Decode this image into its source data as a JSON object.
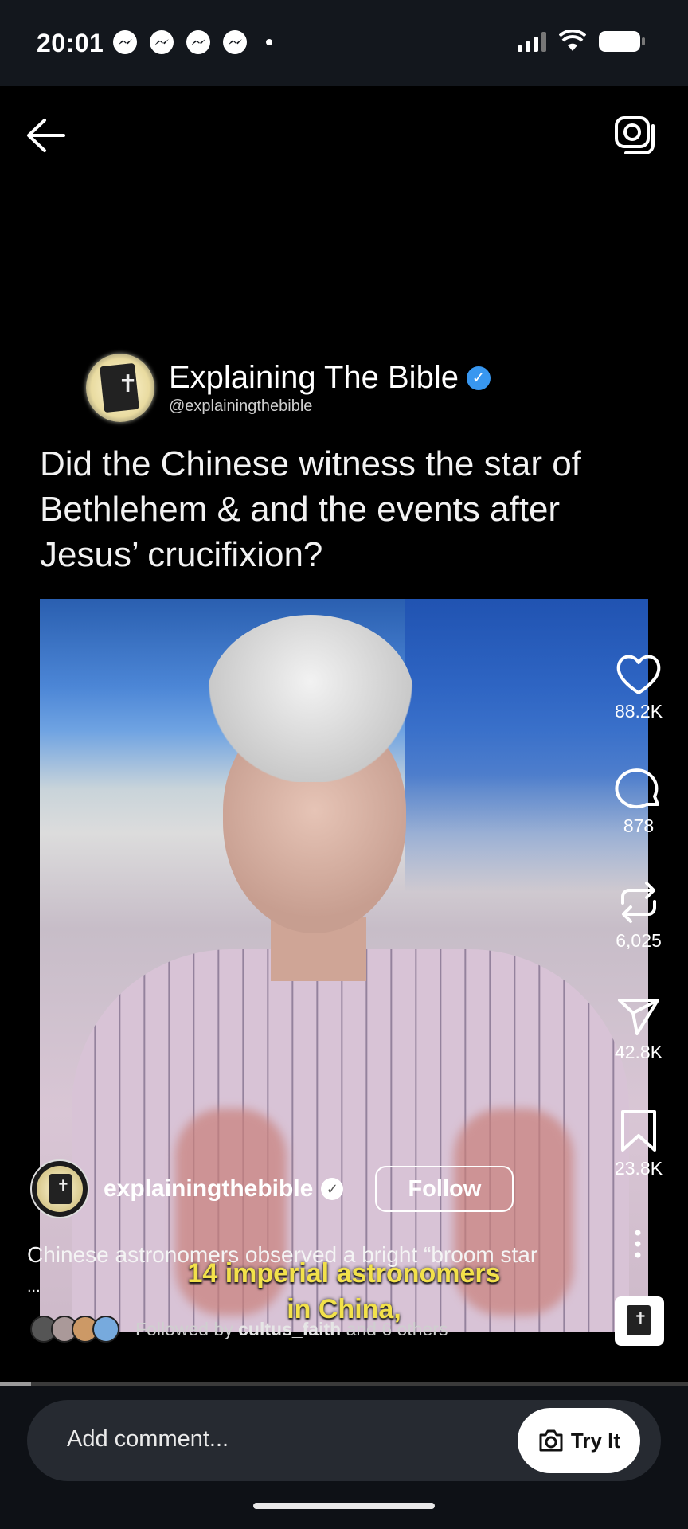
{
  "status_bar": {
    "time": "20:01"
  },
  "post": {
    "author_name": "Explaining The Bible",
    "author_handle": "@explainingthebible",
    "headline": "Did the Chinese witness the star of Bethlehem & and the events after Jesus’ crucifixion?"
  },
  "video": {
    "subtitle_line1": "14 imperial astronomers",
    "subtitle_line2": "in China,",
    "progress_fraction": 0.045
  },
  "actions": {
    "likes": "88.2K",
    "comments": "878",
    "reposts": "6,025",
    "shares": "42.8K",
    "saves": "23.8K"
  },
  "owner": {
    "username": "explainingthebible",
    "follow_label": "Follow"
  },
  "caption": {
    "text": "Chinese astronomers observed a bright “broom star",
    "more": "..."
  },
  "followed_by": {
    "prefix": "Followed by",
    "user": "cultus_faith",
    "suffix": "and 6 others"
  },
  "comment_bar": {
    "placeholder": "Add comment...",
    "try_it_label": "Try It"
  }
}
